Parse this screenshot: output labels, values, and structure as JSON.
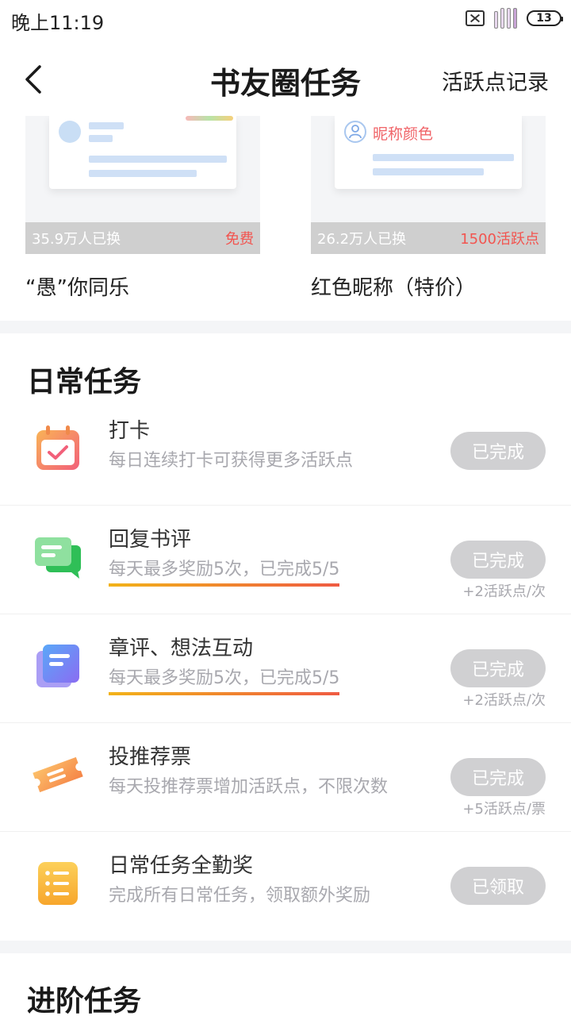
{
  "status_bar": {
    "time": "晚上11:19",
    "battery": "13"
  },
  "header": {
    "title": "书友圈任务",
    "link": "活跃点记录"
  },
  "rewards": [
    {
      "name": "“愚”你同乐",
      "count": "35.9万人已换",
      "price": "免费"
    },
    {
      "name": "红色昵称（特价）",
      "count": "26.2万人已换",
      "price": "1500活跃点",
      "preview_text": "昵称颜色"
    }
  ],
  "daily": {
    "title": "日常任务",
    "tasks": [
      {
        "icon": "calendar-check-icon",
        "title": "打卡",
        "desc": "每日连续打卡可获得更多活跃点",
        "button": "已完成",
        "reward": ""
      },
      {
        "icon": "chat-bubble-icon",
        "title": "回复书评",
        "desc": "每天最多奖励5次，已完成5/5",
        "button": "已完成",
        "reward": "+2活跃点/次"
      },
      {
        "icon": "document-icon",
        "title": "章评、想法互动",
        "desc": "每天最多奖励5次，已完成5/5",
        "button": "已完成",
        "reward": "+2活跃点/次"
      },
      {
        "icon": "ticket-icon",
        "title": "投推荐票",
        "desc": "每天投推荐票增加活跃点，不限次数",
        "button": "已完成",
        "reward": "+5活跃点/票"
      },
      {
        "icon": "list-icon",
        "title": "日常任务全勤奖",
        "desc": "完成所有日常任务，领取额外奖励",
        "button": "已领取",
        "reward": ""
      }
    ]
  },
  "advanced": {
    "title": "进阶任务"
  },
  "colors": {
    "button_done": "#d0d0d2",
    "price_red": "#f2544f",
    "underline_start": "#f2b318",
    "underline_end": "#ef5a42"
  }
}
